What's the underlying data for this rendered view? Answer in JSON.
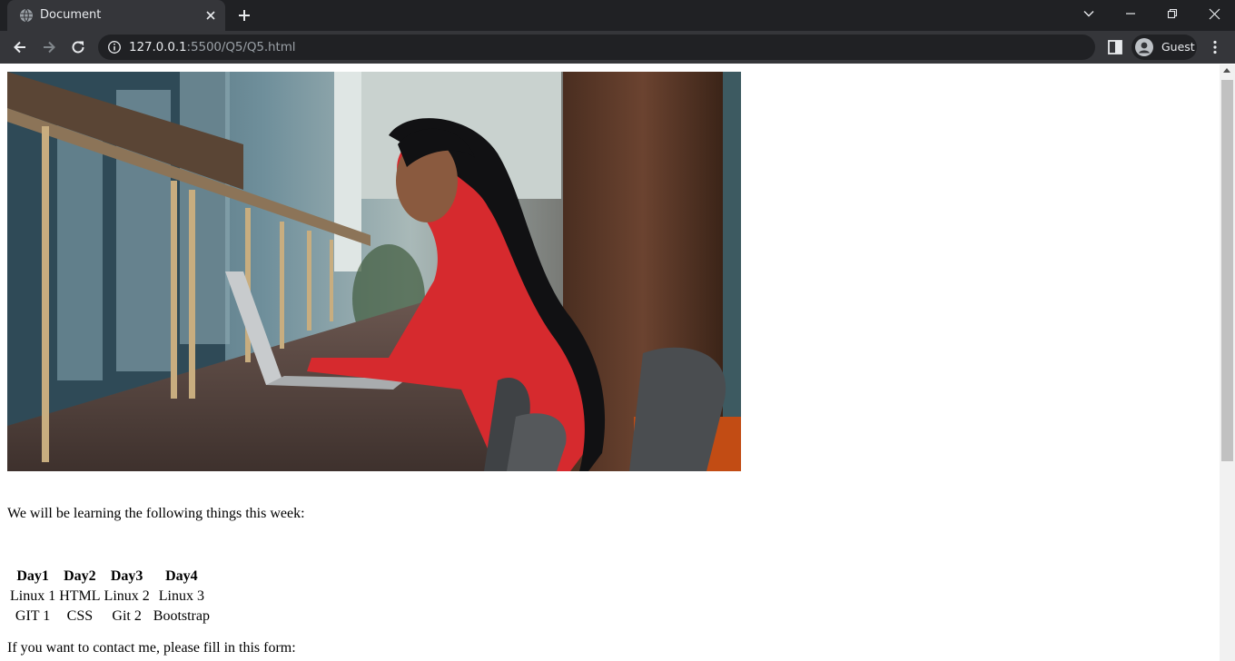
{
  "browser": {
    "tab_title": "Document",
    "url_host": "127.0.0.1",
    "url_path": ":5500/Q5/Q5.html",
    "profile_label": "Guest",
    "icons": [
      "globe-icon",
      "close-icon",
      "plus-icon",
      "chevron-down-icon",
      "minimize-icon",
      "restore-icon",
      "window-close-icon",
      "back-icon",
      "forward-icon",
      "reload-icon",
      "info-icon",
      "side-panel-icon",
      "avatar-icon",
      "kebab-menu-icon"
    ]
  },
  "page": {
    "hero_image": "woman-in-red-sweater-typing-on-laptop",
    "intro_text": "We will be learning the following things this week:",
    "schedule": {
      "headers": [
        "Day1",
        "Day2",
        "Day3",
        "Day4"
      ],
      "rows": [
        [
          "Linux 1",
          "HTML",
          "Linux 2",
          "Linux 3"
        ],
        [
          "GIT 1",
          "CSS",
          "Git 2",
          "Bootstrap"
        ]
      ]
    },
    "contact_text": "If you want to contact me, please fill in this form:"
  }
}
